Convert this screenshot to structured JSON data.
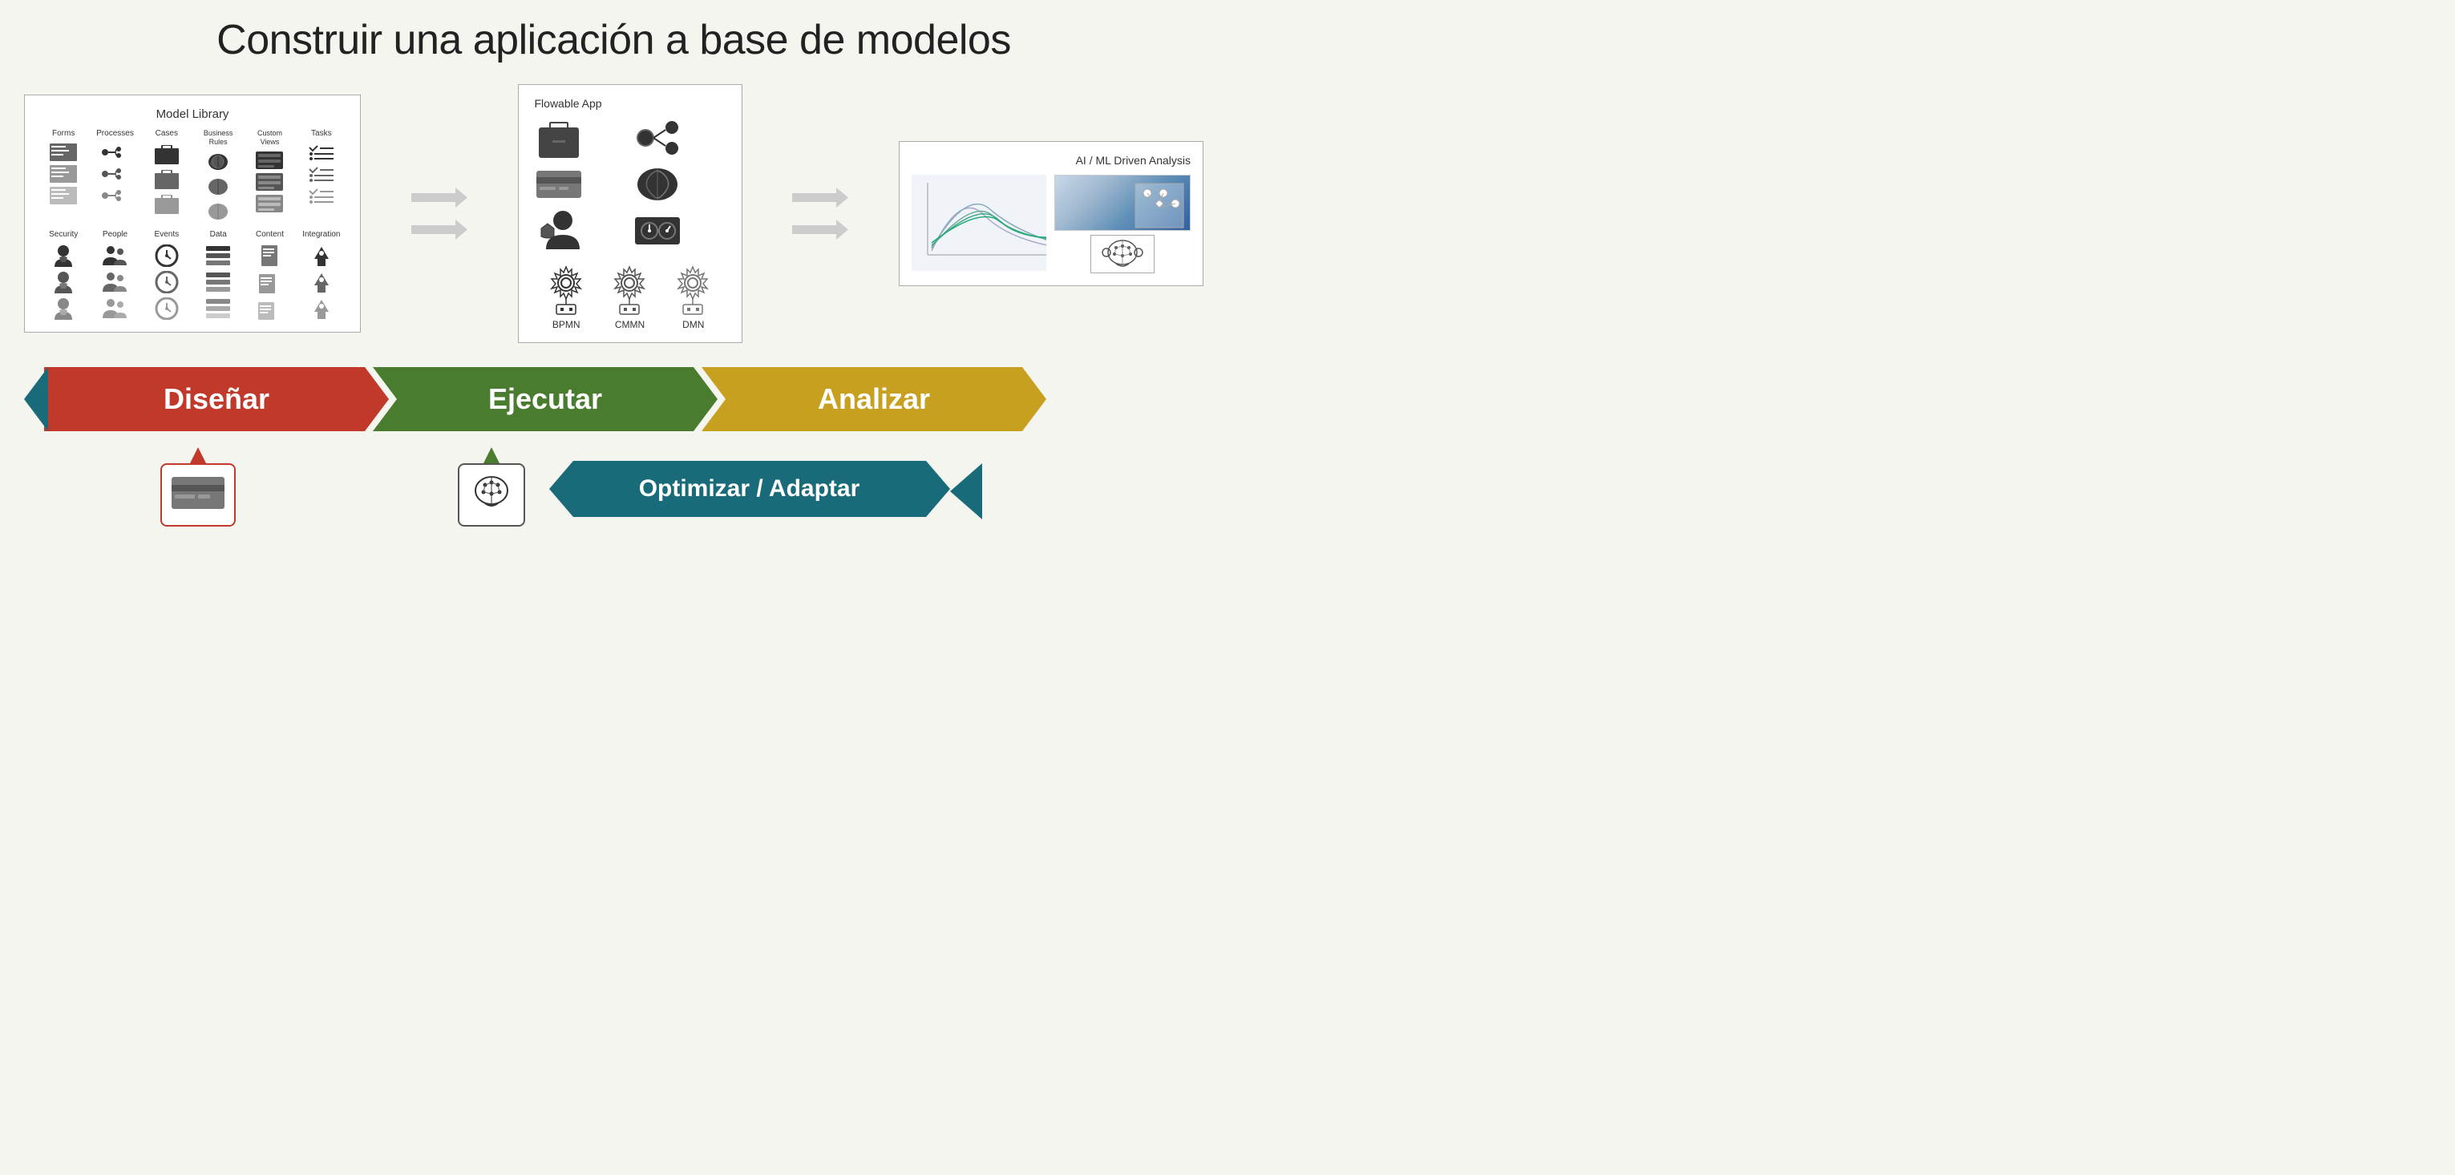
{
  "title": "Construir una aplicación a base de modelos",
  "modelLibrary": {
    "title": "Model Library",
    "columns": [
      {
        "label": "Forms",
        "icons": [
          "form-icon-1",
          "form-icon-2",
          "form-icon-3"
        ]
      },
      {
        "label": "Processes",
        "icons": [
          "process-icon-1",
          "process-icon-2",
          "process-icon-3"
        ]
      },
      {
        "label": "Cases",
        "icons": [
          "cases-icon-1",
          "cases-icon-2",
          "cases-icon-3"
        ]
      },
      {
        "label": "Business Rules",
        "icons": [
          "rules-icon-1",
          "rules-icon-2",
          "rules-icon-3"
        ]
      },
      {
        "label": "Custom Views",
        "icons": [
          "views-icon-1",
          "views-icon-2",
          "views-icon-3"
        ]
      },
      {
        "label": "Tasks",
        "icons": [
          "tasks-icon-1",
          "tasks-icon-2",
          "tasks-icon-3"
        ]
      },
      {
        "label": "Security",
        "icons": [
          "security-icon-1",
          "security-icon-2",
          "security-icon-3"
        ]
      },
      {
        "label": "People",
        "icons": [
          "people-icon-1",
          "people-icon-2",
          "people-icon-3"
        ]
      },
      {
        "label": "Events",
        "icons": [
          "events-icon-1",
          "events-icon-2",
          "events-icon-3"
        ]
      },
      {
        "label": "Data",
        "icons": [
          "data-icon-1",
          "data-icon-2",
          "data-icon-3"
        ]
      },
      {
        "label": "Content",
        "icons": [
          "content-icon-1",
          "content-icon-2",
          "content-icon-3"
        ]
      },
      {
        "label": "Integration",
        "icons": [
          "integration-icon-1",
          "integration-icon-2",
          "integration-icon-3"
        ]
      }
    ]
  },
  "flowableApp": {
    "title": "Flowable App",
    "bottomLabels": [
      "BPMN",
      "CMMN",
      "DMN"
    ]
  },
  "aiMl": {
    "title": "AI / ML Driven Analysis"
  },
  "processSteps": {
    "disenar": "Diseñar",
    "ejecutar": "Ejecutar",
    "analizar": "Analizar",
    "optimizar": "Optimizar / Adaptar"
  },
  "colors": {
    "red": "#c0392b",
    "green": "#4a7c2f",
    "yellow": "#c8a020",
    "teal": "#1a6b7a",
    "blue_outline": "#1a6b7a"
  }
}
